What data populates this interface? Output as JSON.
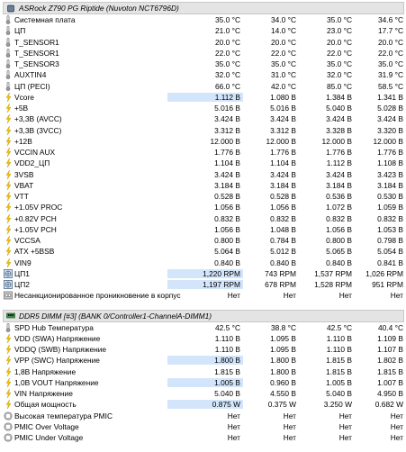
{
  "sections": [
    {
      "title": "ASRock Z790 PG Riptide (Nuvoton NCT6796D)",
      "rows": [
        {
          "label": "Системная плата",
          "icon": "thermometer-icon",
          "values": [
            "35.0 °C",
            "34.0 °C",
            "35.0 °C",
            "34.6 °C"
          ]
        },
        {
          "label": "ЦП",
          "icon": "thermometer-icon",
          "values": [
            "21.0 °C",
            "14.0 °C",
            "23.0 °C",
            "17.7 °C"
          ]
        },
        {
          "label": "T_SENSOR1",
          "icon": "thermometer-icon",
          "values": [
            "20.0 °C",
            "20.0 °C",
            "20.0 °C",
            "20.0 °C"
          ]
        },
        {
          "label": "T_SENSOR1",
          "icon": "thermometer-icon",
          "values": [
            "22.0 °C",
            "22.0 °C",
            "22.0 °C",
            "22.0 °C"
          ]
        },
        {
          "label": "T_SENSOR3",
          "icon": "thermometer-icon",
          "values": [
            "35.0 °C",
            "35.0 °C",
            "35.0 °C",
            "35.0 °C"
          ]
        },
        {
          "label": "AUXTIN4",
          "icon": "thermometer-icon",
          "values": [
            "32.0 °C",
            "31.0 °C",
            "32.0 °C",
            "31.9 °C"
          ]
        },
        {
          "label": "ЦП (PECI)",
          "icon": "thermometer-icon",
          "values": [
            "66.0 °C",
            "42.0 °C",
            "85.0 °C",
            "58.5 °C"
          ]
        },
        {
          "label": "Vcore",
          "icon": "bolt-icon",
          "highlight": true,
          "values": [
            "1.112 В",
            "1.080 В",
            "1.384 В",
            "1.341 В"
          ]
        },
        {
          "label": "+5В",
          "icon": "bolt-icon",
          "values": [
            "5.016 В",
            "5.016 В",
            "5.040 В",
            "5.028 В"
          ]
        },
        {
          "label": "+3,3В (AVCC)",
          "icon": "bolt-icon",
          "values": [
            "3.424 В",
            "3.424 В",
            "3.424 В",
            "3.424 В"
          ]
        },
        {
          "label": "+3,3В (3VCC)",
          "icon": "bolt-icon",
          "values": [
            "3.312 В",
            "3.312 В",
            "3.328 В",
            "3.320 В"
          ]
        },
        {
          "label": "+12В",
          "icon": "bolt-icon",
          "values": [
            "12.000 В",
            "12.000 В",
            "12.000 В",
            "12.000 В"
          ]
        },
        {
          "label": "VCCIN AUX",
          "icon": "bolt-icon",
          "values": [
            "1.776 В",
            "1.776 В",
            "1.776 В",
            "1.776 В"
          ]
        },
        {
          "label": "VDD2_ЦП",
          "icon": "bolt-icon",
          "values": [
            "1.104 В",
            "1.104 В",
            "1.112 В",
            "1.108 В"
          ]
        },
        {
          "label": "3VSB",
          "icon": "bolt-icon",
          "values": [
            "3.424 В",
            "3.424 В",
            "3.424 В",
            "3.423 В"
          ]
        },
        {
          "label": "VBAT",
          "icon": "bolt-icon",
          "values": [
            "3.184 В",
            "3.184 В",
            "3.184 В",
            "3.184 В"
          ]
        },
        {
          "label": "VTT",
          "icon": "bolt-icon",
          "values": [
            "0.528 В",
            "0.528 В",
            "0.536 В",
            "0.530 В"
          ]
        },
        {
          "label": "+1.05V PROC",
          "icon": "bolt-icon",
          "values": [
            "1.056 В",
            "1.056 В",
            "1.072 В",
            "1.059 В"
          ]
        },
        {
          "label": "+0.82V PCH",
          "icon": "bolt-icon",
          "values": [
            "0.832 В",
            "0.832 В",
            "0.832 В",
            "0.832 В"
          ]
        },
        {
          "label": "+1.05V PCH",
          "icon": "bolt-icon",
          "values": [
            "1.056 В",
            "1.048 В",
            "1.056 В",
            "1.053 В"
          ]
        },
        {
          "label": "VCCSA",
          "icon": "bolt-icon",
          "values": [
            "0.800 В",
            "0.784 В",
            "0.800 В",
            "0.798 В"
          ]
        },
        {
          "label": "ATX +5BSB",
          "icon": "bolt-icon",
          "values": [
            "5.064 В",
            "5.012 В",
            "5.065 В",
            "5.054 В"
          ]
        },
        {
          "label": "VIN9",
          "icon": "bolt-icon",
          "values": [
            "0.840 В",
            "0.840 В",
            "0.840 В",
            "0.841 В"
          ]
        },
        {
          "label": "ЦП1",
          "icon": "fan-icon",
          "highlight": true,
          "values": [
            "1,220 RPM",
            "743 RPM",
            "1,537 RPM",
            "1,026 RPM"
          ]
        },
        {
          "label": "ЦП2",
          "icon": "fan-icon",
          "highlight": true,
          "values": [
            "1,197 RPM",
            "678 RPM",
            "1,528 RPM",
            "951 RPM"
          ]
        },
        {
          "label": "Несанкционированное проникновение в корпус",
          "icon": "chassis-icon",
          "values": [
            "Нет",
            "Нет",
            "Нет",
            "Нет"
          ]
        }
      ]
    },
    {
      "title": "DDR5 DIMM [#3] (BANK 0/Controller1-ChannelA-DIMM1)",
      "rows": [
        {
          "label": "SPD Hub Температура",
          "icon": "thermometer-icon",
          "values": [
            "42.5 °C",
            "38.8 °C",
            "42.5 °C",
            "40.4 °C"
          ]
        },
        {
          "label": "VDD (SWA) Напряжение",
          "icon": "bolt-icon",
          "values": [
            "1.110 В",
            "1.095 В",
            "1.110 В",
            "1.109 В"
          ]
        },
        {
          "label": "VDDQ (SWB) Напряжение",
          "icon": "bolt-icon",
          "values": [
            "1.110 В",
            "1.095 В",
            "1.110 В",
            "1.107 В"
          ]
        },
        {
          "label": "VPP (SWC) Напряжение",
          "icon": "bolt-icon",
          "highlight": true,
          "values": [
            "1.800 В",
            "1.800 В",
            "1.815 В",
            "1.802 В"
          ]
        },
        {
          "label": "1,8В Напряжение",
          "icon": "bolt-icon",
          "values": [
            "1.815 В",
            "1.800 В",
            "1.815 В",
            "1.815 В"
          ]
        },
        {
          "label": "1,0В VOUT Напряжение",
          "icon": "bolt-icon",
          "highlight": true,
          "values": [
            "1.005 В",
            "0.960 В",
            "1.005 В",
            "1.007 В"
          ]
        },
        {
          "label": "VIN Напряжение",
          "icon": "bolt-icon",
          "values": [
            "5.040 В",
            "4.550 В",
            "5.040 В",
            "4.950 В"
          ]
        },
        {
          "label": "Общая мощность",
          "icon": "bolt-icon",
          "highlight": true,
          "values": [
            "0.875 W",
            "0.375 W",
            "3.250 W",
            "0.682 W"
          ]
        },
        {
          "label": "Высокая температура PMIC",
          "icon": "status-icon",
          "values": [
            "Нет",
            "Нет",
            "Нет",
            "Нет"
          ]
        },
        {
          "label": "PMIC Over Voltage",
          "icon": "status-icon",
          "values": [
            "Нет",
            "Нет",
            "Нет",
            "Нет"
          ]
        },
        {
          "label": "PMIC Under Voltage",
          "icon": "status-icon",
          "values": [
            "Нет",
            "Нет",
            "Нет",
            "Нет"
          ]
        }
      ]
    }
  ],
  "colors": {
    "highlight": "#d3e5fb",
    "header_bg": "#e4e4e4",
    "bolt": "#f2c418",
    "thermo": "#8a8a8a",
    "fan": "#4a6a8a"
  }
}
